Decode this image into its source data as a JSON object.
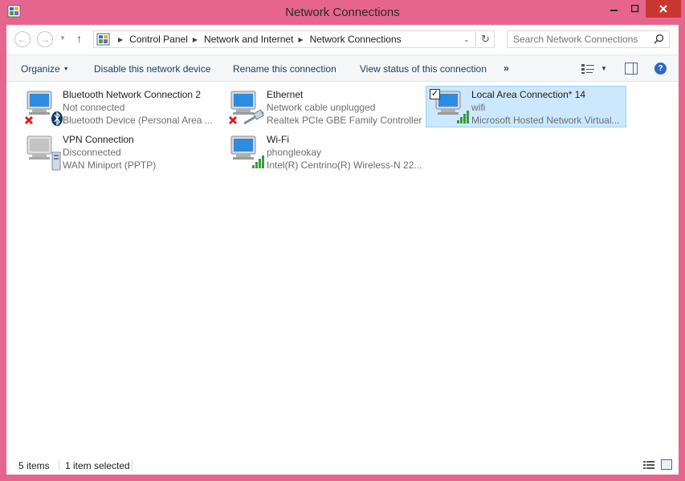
{
  "window": {
    "title": "Network Connections",
    "accent": "#e6658f",
    "close_color": "#c7372f",
    "controls": {
      "minimize": "minimize-icon",
      "maximize": "maximize-icon",
      "close": "close-icon"
    }
  },
  "address": {
    "crumbs": [
      "Control Panel",
      "Network and Internet",
      "Network Connections"
    ]
  },
  "search": {
    "placeholder": "Search Network Connections"
  },
  "commands": {
    "organize": "Organize",
    "disable": "Disable this network device",
    "rename": "Rename this connection",
    "status": "View status of this connection",
    "more": "»"
  },
  "items": [
    {
      "name": "Bluetooth Network Connection 2",
      "status": "Not connected",
      "device": "Bluetooth Device (Personal Area ...",
      "icon": "bluetooth-network-icon",
      "badge": "disconnected-x-icon"
    },
    {
      "name": "Ethernet",
      "status": "Network cable unplugged",
      "device": "Realtek PCIe GBE Family Controller",
      "icon": "ethernet-network-icon",
      "badge": "disconnected-x-icon"
    },
    {
      "name": "Local Area Connection* 14",
      "status": "wifi",
      "device": "Microsoft Hosted Network Virtual...",
      "icon": "wireless-network-icon",
      "selected": true,
      "checked": true
    },
    {
      "name": "VPN Connection",
      "status": "Disconnected",
      "device": "WAN Miniport (PPTP)",
      "icon": "vpn-network-icon"
    },
    {
      "name": "Wi-Fi",
      "status": "phongleokay",
      "device": "Intel(R) Centrino(R) Wireless-N 22...",
      "icon": "wireless-network-icon"
    }
  ],
  "statusbar": {
    "count": "5 items",
    "selected": "1 item selected"
  },
  "colors": {
    "selection_bg": "#cce8ff",
    "selection_border": "#99d1ff",
    "command_text": "#1e3d5c",
    "sub_text": "#6d6d6d"
  }
}
